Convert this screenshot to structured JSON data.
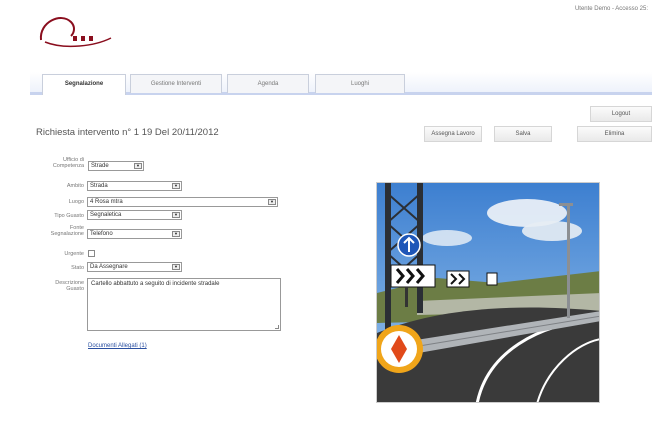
{
  "header": {
    "user_info": "Utente Demo - Accesso 25:"
  },
  "tabs": [
    {
      "label": "Segnalazione",
      "active": true
    },
    {
      "label": "Gestione Interventi",
      "active": false
    },
    {
      "label": "Agenda",
      "active": false
    },
    {
      "label": "Luoghi",
      "active": false
    }
  ],
  "toolbar": {
    "logout_label": "Logout",
    "assign_label": "Assegna Lavoro",
    "save_label": "Salva",
    "delete_label": "Elimina"
  },
  "page": {
    "title": "Richiesta intervento n° 1 19 Del 20/11/2012"
  },
  "form": {
    "ufficio_label": "Ufficio di Competenza",
    "ufficio_value": "Strade",
    "ambito_label": "Ambito",
    "ambito_value": "Strada",
    "luogo_label": "Luogo",
    "luogo_value": "4 Rosa mtra",
    "tipo_label": "Tipo Guasto",
    "tipo_value": "Segnaletica",
    "fonte_label": "Fonte Segnalazione",
    "fonte_value": "Telefono",
    "urgente_label": "Urgente",
    "stato_label": "Stato",
    "stato_value": "Da Assegnare",
    "descrizione_label": "Descrizione Guasto",
    "descrizione_value": "Cartello abbattuto a seguito di incidente stradale",
    "documenti_link": "Documenti Allegati (1)"
  },
  "colors": {
    "brand_red": "#8a0e1e",
    "tab_border": "#c8d3ee",
    "link_blue": "#2a4fa0"
  }
}
